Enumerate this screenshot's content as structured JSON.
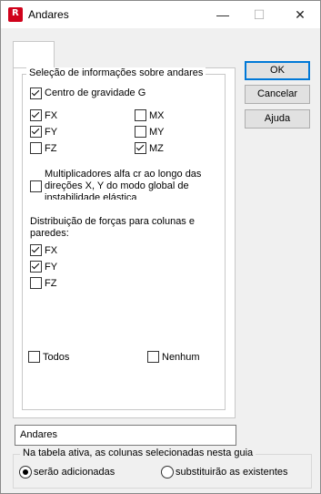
{
  "window": {
    "title": "Andares",
    "app_icon_letter": "R"
  },
  "titlebar": {
    "minimize_glyph": "—",
    "maximize_glyph": "☐",
    "close_glyph": "✕"
  },
  "group": {
    "title": "Seleção de informações sobre andares"
  },
  "items": {
    "centro": {
      "label": "Centro de gravidade G",
      "checked": true
    },
    "fx": {
      "label": "FX",
      "checked": true
    },
    "fy": {
      "label": "FY",
      "checked": true
    },
    "fz": {
      "label": "FZ",
      "checked": false
    },
    "mx": {
      "label": "MX",
      "checked": false
    },
    "my": {
      "label": "MY",
      "checked": false
    },
    "mz": {
      "label": "MZ",
      "checked": true
    },
    "mult": {
      "line1": "Multiplicadores alfa cr ao longo das",
      "line2": "direções X, Y do modo global de",
      "line3": "instabilidade elástica",
      "checked": false
    },
    "dist_title1": "Distribuição de forças para colunas e",
    "dist_title2": "paredes:",
    "dfx": {
      "label": "FX",
      "checked": true
    },
    "dfy": {
      "label": "FY",
      "checked": true
    },
    "dfz": {
      "label": "FZ",
      "checked": false
    },
    "todos": {
      "label": "Todos",
      "checked": false
    },
    "nenhum": {
      "label": "Nenhum",
      "checked": false
    }
  },
  "buttons": {
    "ok": "OK",
    "cancel": "Cancelar",
    "help": "Ajuda"
  },
  "table_name": {
    "value": "Andares"
  },
  "table_options": {
    "legend": "Na tabela ativa, as colunas selecionadas nesta guia",
    "option_add": "serão adicionadas",
    "option_replace": "substituirão as existentes",
    "selected": "add"
  },
  "colors": {
    "accent": "#0078d7",
    "app_icon": "#d0021b"
  }
}
